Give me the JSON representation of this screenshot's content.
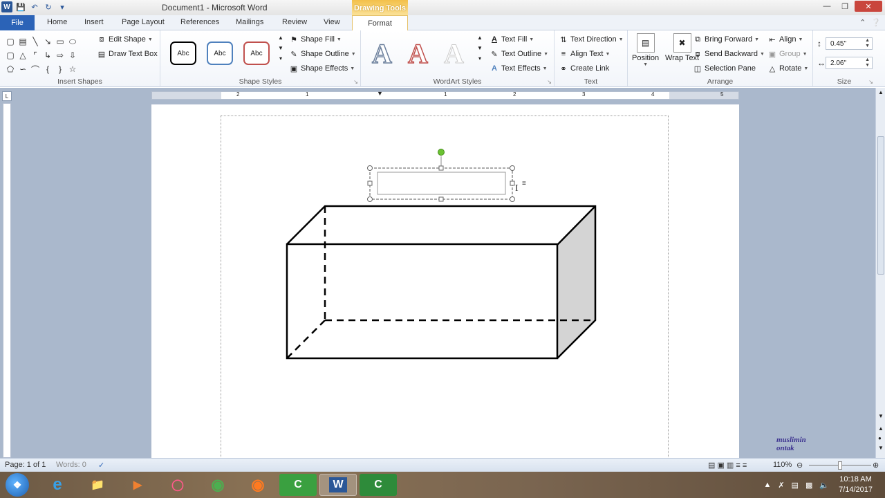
{
  "window": {
    "title": "Document1 - Microsoft Word",
    "contextual_tab": "Drawing Tools"
  },
  "tabs": [
    "File",
    "Home",
    "Insert",
    "Page Layout",
    "References",
    "Mailings",
    "Review",
    "View",
    "Format"
  ],
  "ribbon": {
    "insert_shapes": {
      "edit_shape": "Edit Shape",
      "draw_text_box": "Draw Text Box",
      "label": "Insert Shapes"
    },
    "shape_styles": {
      "styles": [
        "Abc",
        "Abc",
        "Abc"
      ],
      "style_colors": [
        "#000000",
        "#4f81bd",
        "#c0504d"
      ],
      "shape_fill": "Shape Fill",
      "shape_outline": "Shape Outline",
      "shape_effects": "Shape Effects",
      "label": "Shape Styles"
    },
    "wordart_styles": {
      "letters": [
        "A",
        "A",
        "A"
      ],
      "text_fill": "Text Fill",
      "text_outline": "Text Outline",
      "text_effects": "Text Effects",
      "label": "WordArt Styles"
    },
    "text": {
      "text_direction": "Text Direction",
      "align_text": "Align Text",
      "create_link": "Create Link",
      "label": "Text"
    },
    "arrange": {
      "position": "Position",
      "wrap_text": "Wrap Text",
      "bring_forward": "Bring Forward",
      "send_backward": "Send Backward",
      "selection_pane": "Selection Pane",
      "align": "Align",
      "group": "Group",
      "rotate": "Rotate",
      "label": "Arrange"
    },
    "size": {
      "height": "0.45\"",
      "width": "2.06\"",
      "label": "Size"
    }
  },
  "ruler_numbers": [
    "2",
    "1",
    "1",
    "2",
    "3",
    "4",
    "5"
  ],
  "watermark": {
    "text": "muslimin ontak"
  },
  "status": {
    "page": "Page: 1 of 1",
    "words": "Words: 0",
    "zoom": "110%"
  },
  "taskbar": {
    "time": "10:18 AM",
    "date": "7/14/2017"
  }
}
